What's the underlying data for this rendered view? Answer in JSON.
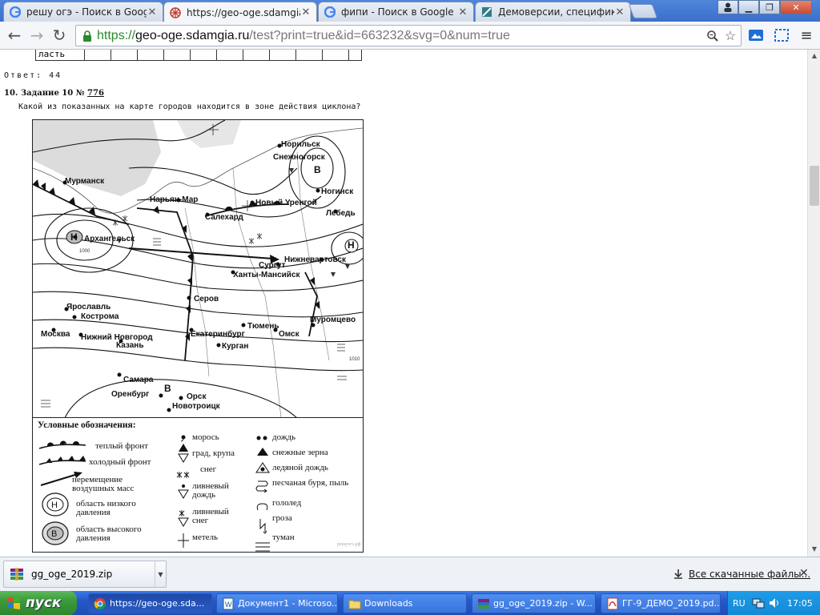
{
  "browser": {
    "tabs": [
      {
        "label": "решу огэ - Поиск в Google",
        "icon": "google-icon",
        "active": false
      },
      {
        "label": "https://geo-oge.sdamgia.ru/",
        "icon": "sdamgia-icon",
        "active": true
      },
      {
        "label": "фипи - Поиск в Google",
        "icon": "google-icon",
        "active": false
      },
      {
        "label": "Демоверсии, спецификаци",
        "icon": "fipi-icon",
        "active": false
      }
    ],
    "url": {
      "scheme": "https://",
      "host": "geo-oge.sdamgia.ru",
      "path": "/test?print=true&id=663232&svg=0&num=true"
    }
  },
  "page": {
    "prev_row_label": "ласть",
    "answer": "Ответ: 44",
    "task": {
      "prefix": "10. Задание 10 № ",
      "number": "776",
      "question": "Какой из показанных на карте городов находится в зоне действия циклона?"
    },
    "map": {
      "cities": [
        "Норильск",
        "Снежногорск",
        "Ногинск",
        "Лебедь",
        "Мурманск",
        "Нарьян-Мар",
        "Салехард",
        "Новый Уренгой",
        "Архангельск",
        "Сургут",
        "Нижневартовск",
        "Ханты-Мансийск",
        "Серов",
        "Ярославль",
        "Кострома",
        "Москва",
        "Тюмень",
        "Муромцево",
        "Нижний Новгород",
        "Казань",
        "Екатеринбург",
        "Омск",
        "Курган",
        "Самара",
        "Оренбург",
        "Орск",
        "Новотроицк"
      ],
      "pressure_marks": {
        "low": "Н",
        "high": "В"
      }
    },
    "legend": {
      "title": "Условные обозначения:",
      "items": {
        "warm_front": "теплый фронт",
        "cold_front": "холодный фронт",
        "air_movement": "перемещение воздушных масс",
        "low_pressure": "область низкого давления",
        "high_pressure": "область высокого давления",
        "drizzle": "морось",
        "hail": "град, крупа",
        "snow": "снег",
        "shower_rain": "ливневый дождь",
        "shower_snow": "ливневый снег",
        "blizzard": "метель",
        "rain": "дождь",
        "snow_grains": "снежные зерна",
        "freezing_rain": "ледяной дождь",
        "sandstorm": "песчаная буря, пыль",
        "ice": "гололед",
        "thunderstorm": "гроза",
        "fog": "туман"
      },
      "watermark": "решуогэ.рф"
    }
  },
  "downloads": {
    "file": "gg_oge_2019.zip",
    "all_link": "Все скачанные файлы..."
  },
  "taskbar": {
    "start": "пуск",
    "tasks": [
      "https://geo-oge.sda...",
      "Документ1 - Microso...",
      "Downloads",
      "gg_oge_2019.zip - W...",
      "ГГ-9_ДЕМО_2019.pd..."
    ],
    "lang": "RU",
    "clock": "17:05"
  }
}
